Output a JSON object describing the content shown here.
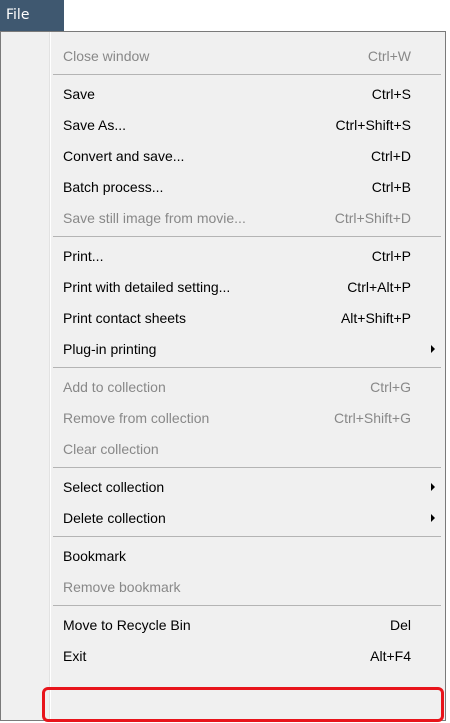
{
  "menubar": {
    "title": "File"
  },
  "menu": {
    "items": [
      {
        "label": "Close window",
        "shortcut": "Ctrl+W",
        "disabled": true
      },
      {
        "separator": true
      },
      {
        "label": "Save",
        "shortcut": "Ctrl+S"
      },
      {
        "label": "Save As...",
        "shortcut": "Ctrl+Shift+S"
      },
      {
        "label": "Convert and save...",
        "shortcut": "Ctrl+D"
      },
      {
        "label": "Batch process...",
        "shortcut": "Ctrl+B"
      },
      {
        "label": "Save still image from movie...",
        "shortcut": "Ctrl+Shift+D",
        "disabled": true
      },
      {
        "separator": true
      },
      {
        "label": "Print...",
        "shortcut": "Ctrl+P"
      },
      {
        "label": "Print with detailed setting...",
        "shortcut": "Ctrl+Alt+P"
      },
      {
        "label": "Print contact sheets",
        "shortcut": "Alt+Shift+P"
      },
      {
        "label": "Plug-in printing",
        "shortcut": "",
        "submenu": true
      },
      {
        "separator": true
      },
      {
        "label": "Add to collection",
        "shortcut": "Ctrl+G",
        "disabled": true
      },
      {
        "label": "Remove from collection",
        "shortcut": "Ctrl+Shift+G",
        "disabled": true
      },
      {
        "label": "Clear collection",
        "shortcut": "",
        "disabled": true
      },
      {
        "separator": true
      },
      {
        "label": "Select collection",
        "shortcut": "",
        "submenu": true
      },
      {
        "label": "Delete collection",
        "shortcut": "",
        "submenu": true
      },
      {
        "separator": true
      },
      {
        "label": "Bookmark",
        "shortcut": ""
      },
      {
        "label": "Remove bookmark",
        "shortcut": "",
        "disabled": true
      },
      {
        "separator": true
      },
      {
        "label": "Move to Recycle Bin",
        "shortcut": "Del"
      },
      {
        "label": "Exit",
        "shortcut": "Alt+F4",
        "highlighted": true
      }
    ]
  },
  "colors": {
    "menubar_bg": "#3f5870",
    "highlight_border": "#e8141b",
    "disabled_text": "#888888"
  }
}
